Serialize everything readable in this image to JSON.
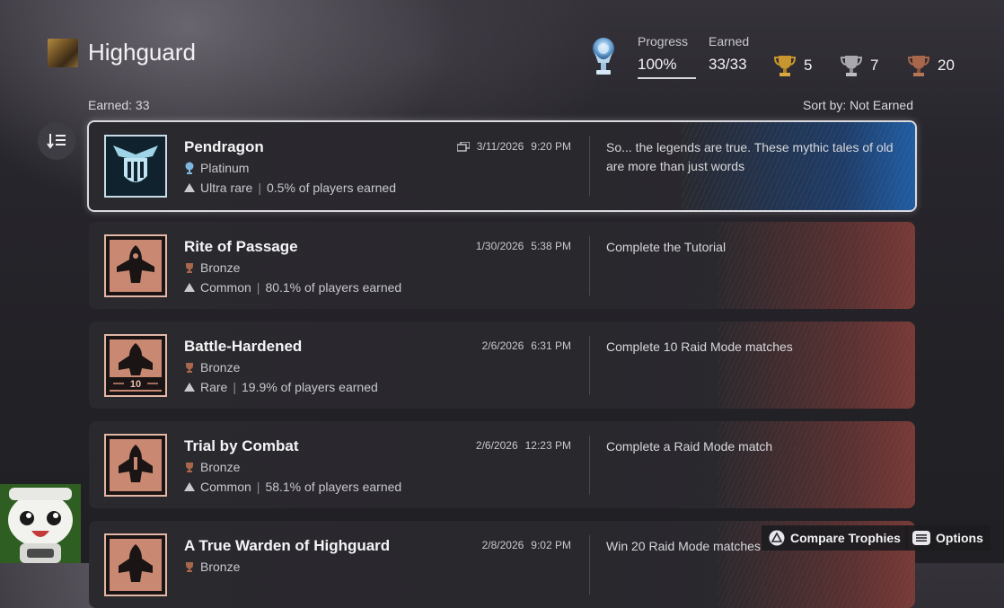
{
  "header": {
    "game_title": "Highguard",
    "progress_label": "Progress",
    "progress_value": "100%",
    "progress_fraction": 1.0,
    "earned_label": "Earned",
    "earned_value": "33/33",
    "gold_count": "5",
    "silver_count": "7",
    "bronze_count": "20"
  },
  "list_header": {
    "earned_count": "Earned: 33",
    "sort_label": "Sort by: Not Earned"
  },
  "colors": {
    "platinum": "#7fb6e0",
    "gold": "#c8962e",
    "silver": "#a8a8ae",
    "bronze": "#a8664a"
  },
  "trophies": [
    {
      "name": "Pendragon",
      "grade": "Platinum",
      "rarity": "Ultra rare",
      "percent": "0.5% of players earned",
      "date": "3/11/2026",
      "time": "9:20 PM",
      "description": "So... the legends are true. These mythic tales of old are more than just words",
      "icon": "platinum-pendragon-emblem"
    },
    {
      "name": "Rite of Passage",
      "grade": "Bronze",
      "rarity": "Common",
      "percent": "80.1% of players earned",
      "date": "1/30/2026",
      "time": "5:38 PM",
      "description": "Complete the Tutorial",
      "icon": "ship-silhouette"
    },
    {
      "name": "Battle-Hardened",
      "grade": "Bronze",
      "rarity": "Rare",
      "percent": "19.9% of players earned",
      "date": "2/6/2026",
      "time": "6:31 PM",
      "description": "Complete 10 Raid Mode matches",
      "icon": "ship-10-badge",
      "badge_number": "10"
    },
    {
      "name": "Trial by Combat",
      "grade": "Bronze",
      "rarity": "Common",
      "percent": "58.1% of players earned",
      "date": "2/6/2026",
      "time": "12:23 PM",
      "description": "Complete a Raid Mode match",
      "icon": "ship-badge"
    },
    {
      "name": "A True Warden of Highguard",
      "grade": "Bronze",
      "date": "2/8/2026",
      "time": "9:02 PM",
      "description": "Win 20 Raid Mode matches",
      "icon": "ship-badge"
    }
  ],
  "footer": {
    "compare_label": "Compare Trophies",
    "options_label": "Options"
  }
}
